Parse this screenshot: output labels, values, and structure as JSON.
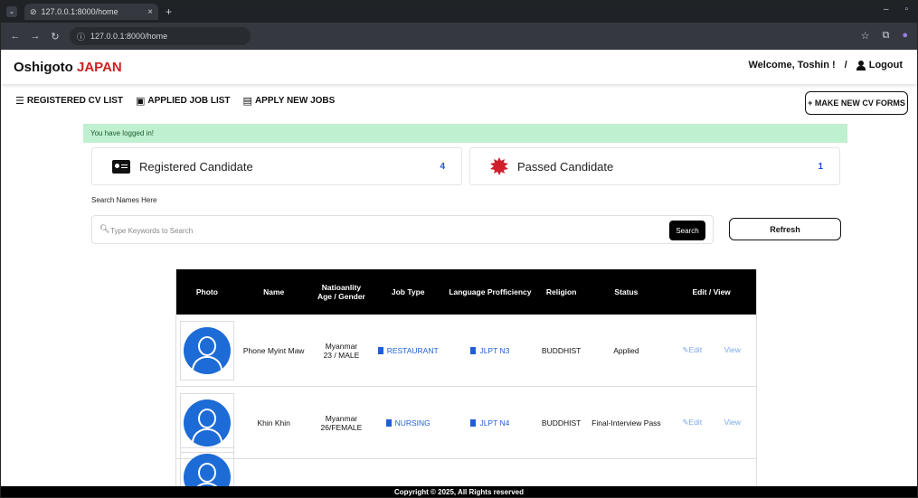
{
  "browser": {
    "tab_title": "127.0.0.1:8000/home",
    "url": "127.0.0.1:8000/home"
  },
  "header": {
    "brand_main": "Oshigoto",
    "brand_accent": "JAPAN",
    "welcome": "Welcome, Toshin !",
    "separator": "/",
    "logout": "Logout"
  },
  "nav": {
    "items": [
      {
        "icon": "list-icon",
        "label": "REGISTERED CV LIST"
      },
      {
        "icon": "briefcase-icon",
        "label": "APPLIED JOB LIST"
      },
      {
        "icon": "newspaper-icon",
        "label": "APPLY NEW JOBS"
      }
    ],
    "make_new": "+ MAKE NEW CV FORMS"
  },
  "alert": "You have logged in!",
  "cards": [
    {
      "icon": "id-card-icon",
      "title": "Registered Candidate",
      "count": "4"
    },
    {
      "icon": "seal-icon",
      "title": "Passed Candidate",
      "count": "1"
    }
  ],
  "search": {
    "label": "Search Names Here",
    "placeholder": "Type Keywords to Search",
    "button": "Search",
    "refresh": "Refresh"
  },
  "table": {
    "headers": {
      "photo": "Photo",
      "name": "Name",
      "nat_line1": "Natioanlity",
      "nat_line2": "Age / Gender",
      "job": "Job Type",
      "lang": "Language Profficiency",
      "religion": "Religion",
      "status": "Status",
      "edit_view": "Edit / View"
    },
    "rows": [
      {
        "name": "Phone Myint Maw",
        "nationality": "Myanmar",
        "age_gender": "23 / MALE",
        "job": "RESTAURANT",
        "lang": "JLPT N3",
        "religion": "BUDDHIST",
        "status": "Applied",
        "edit": "Edit",
        "view": "View"
      },
      {
        "name": "Khin Khin",
        "nationality": "Myanmar",
        "age_gender": "26/FEMALE",
        "job": "NURSING",
        "lang": "JLPT N4",
        "religion": "BUDDHIST",
        "status": "Final-Interview Pass",
        "edit": "Edit",
        "view": "View"
      }
    ]
  },
  "footer": "Copyright © 2025, All Rights reserved",
  "colors": {
    "brand_accent": "#d21f1f",
    "alert_bg": "#bff0cf",
    "avatar_blue": "#1d6bd6",
    "link_blue": "#1f5fd6",
    "seal_red": "#d0202a"
  }
}
